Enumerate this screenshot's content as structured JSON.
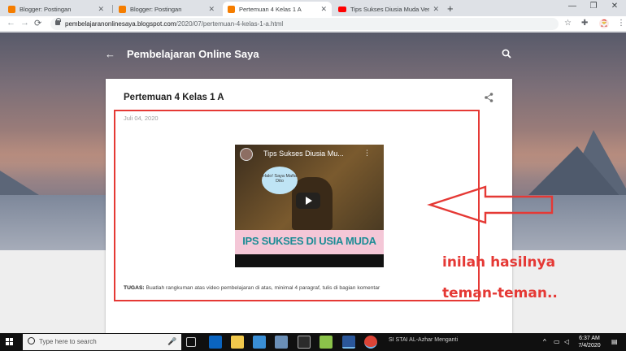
{
  "browser": {
    "tabs": [
      {
        "title": "Blogger: Postingan",
        "favicon": "blogger-icon",
        "active": false
      },
      {
        "title": "Blogger: Postingan",
        "favicon": "blogger-icon",
        "active": false
      },
      {
        "title": "Pertemuan 4 Kelas 1 A",
        "favicon": "blogger-icon",
        "active": true
      },
      {
        "title": "Tips Sukses Diusia Muda Versi Al...",
        "favicon": "youtube-icon",
        "active": false
      }
    ],
    "new_tab": "+",
    "url_domain": "pembelajaranonlinesaya.blogspot.com",
    "url_path": "/2020/07/pertemuan-4-kelas-1-a.html"
  },
  "blog": {
    "title": "Pembelajaran Online Saya",
    "back_icon": "←",
    "search_icon": "⌕"
  },
  "post": {
    "title": "Pertemuan 4 Kelas 1 A",
    "date": "Juli 04, 2020",
    "share_icon": "share-icon",
    "video": {
      "title": "Tips Sukses Diusia Mu...",
      "bubble_text": "Halo! Saya Mafia Dito",
      "banner_text": "IPS SUKSES DI USIA MUDA"
    },
    "task_label": "TUGAS:",
    "task_text": " Buatlah rangkuman atas  video pembelajaran di atas, minimal 4 paragraf, tulis di bagian komentar"
  },
  "annotation": {
    "line1": "inilah hasilnya",
    "line2": "teman-teman..",
    "color": "#e53935"
  },
  "taskbar": {
    "search_placeholder": "Type here to search",
    "time": "6:37 AM",
    "date": "7/4/2020",
    "background_text": "SI STAI AL-Azhar Menganti"
  }
}
